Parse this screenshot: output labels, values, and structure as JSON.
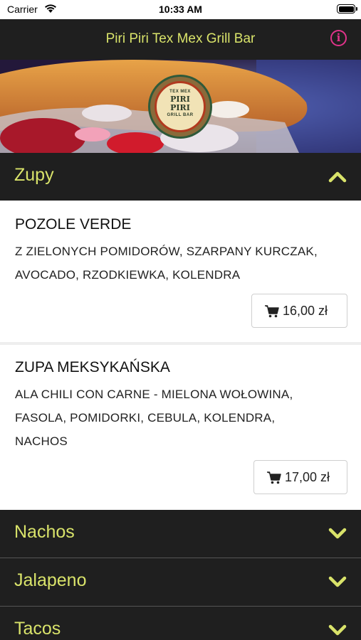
{
  "status_bar": {
    "carrier": "Carrier",
    "time": "10:33 AM"
  },
  "nav": {
    "title": "Piri Piri Tex Mex Grill Bar",
    "info_icon": "info-icon",
    "accent_color": "#e0338a",
    "title_color": "#d9e36a"
  },
  "hero": {
    "logo": {
      "top_text": "TEX MEX",
      "main_text_1": "PIRI",
      "main_text_2": "PIRI",
      "bottom_text": "GRILL BAR"
    }
  },
  "sections": [
    {
      "label": "Zupy",
      "expanded": true
    },
    {
      "label": "Nachos",
      "expanded": false
    },
    {
      "label": "Jalapeno",
      "expanded": false
    },
    {
      "label": "Tacos",
      "expanded": false
    }
  ],
  "items": [
    {
      "name": "POZOLE VERDE",
      "desc_lines": [
        "Z ZIELONYCH POMIDORÓW, SZARPANY KURCZAK,",
        "AVOCADO, RZODKIEWKA, KOLENDRA"
      ],
      "price": "16,00 zł"
    },
    {
      "name": "ZUPA MEKSYKAŃSKA",
      "desc_lines": [
        "ALA CHILI CON CARNE - MIELONA WOŁOWINA,",
        "FASOLA, POMIDORKI, CEBULA, KOLENDRA,",
        "NACHOS"
      ],
      "price": "17,00 zł"
    }
  ]
}
